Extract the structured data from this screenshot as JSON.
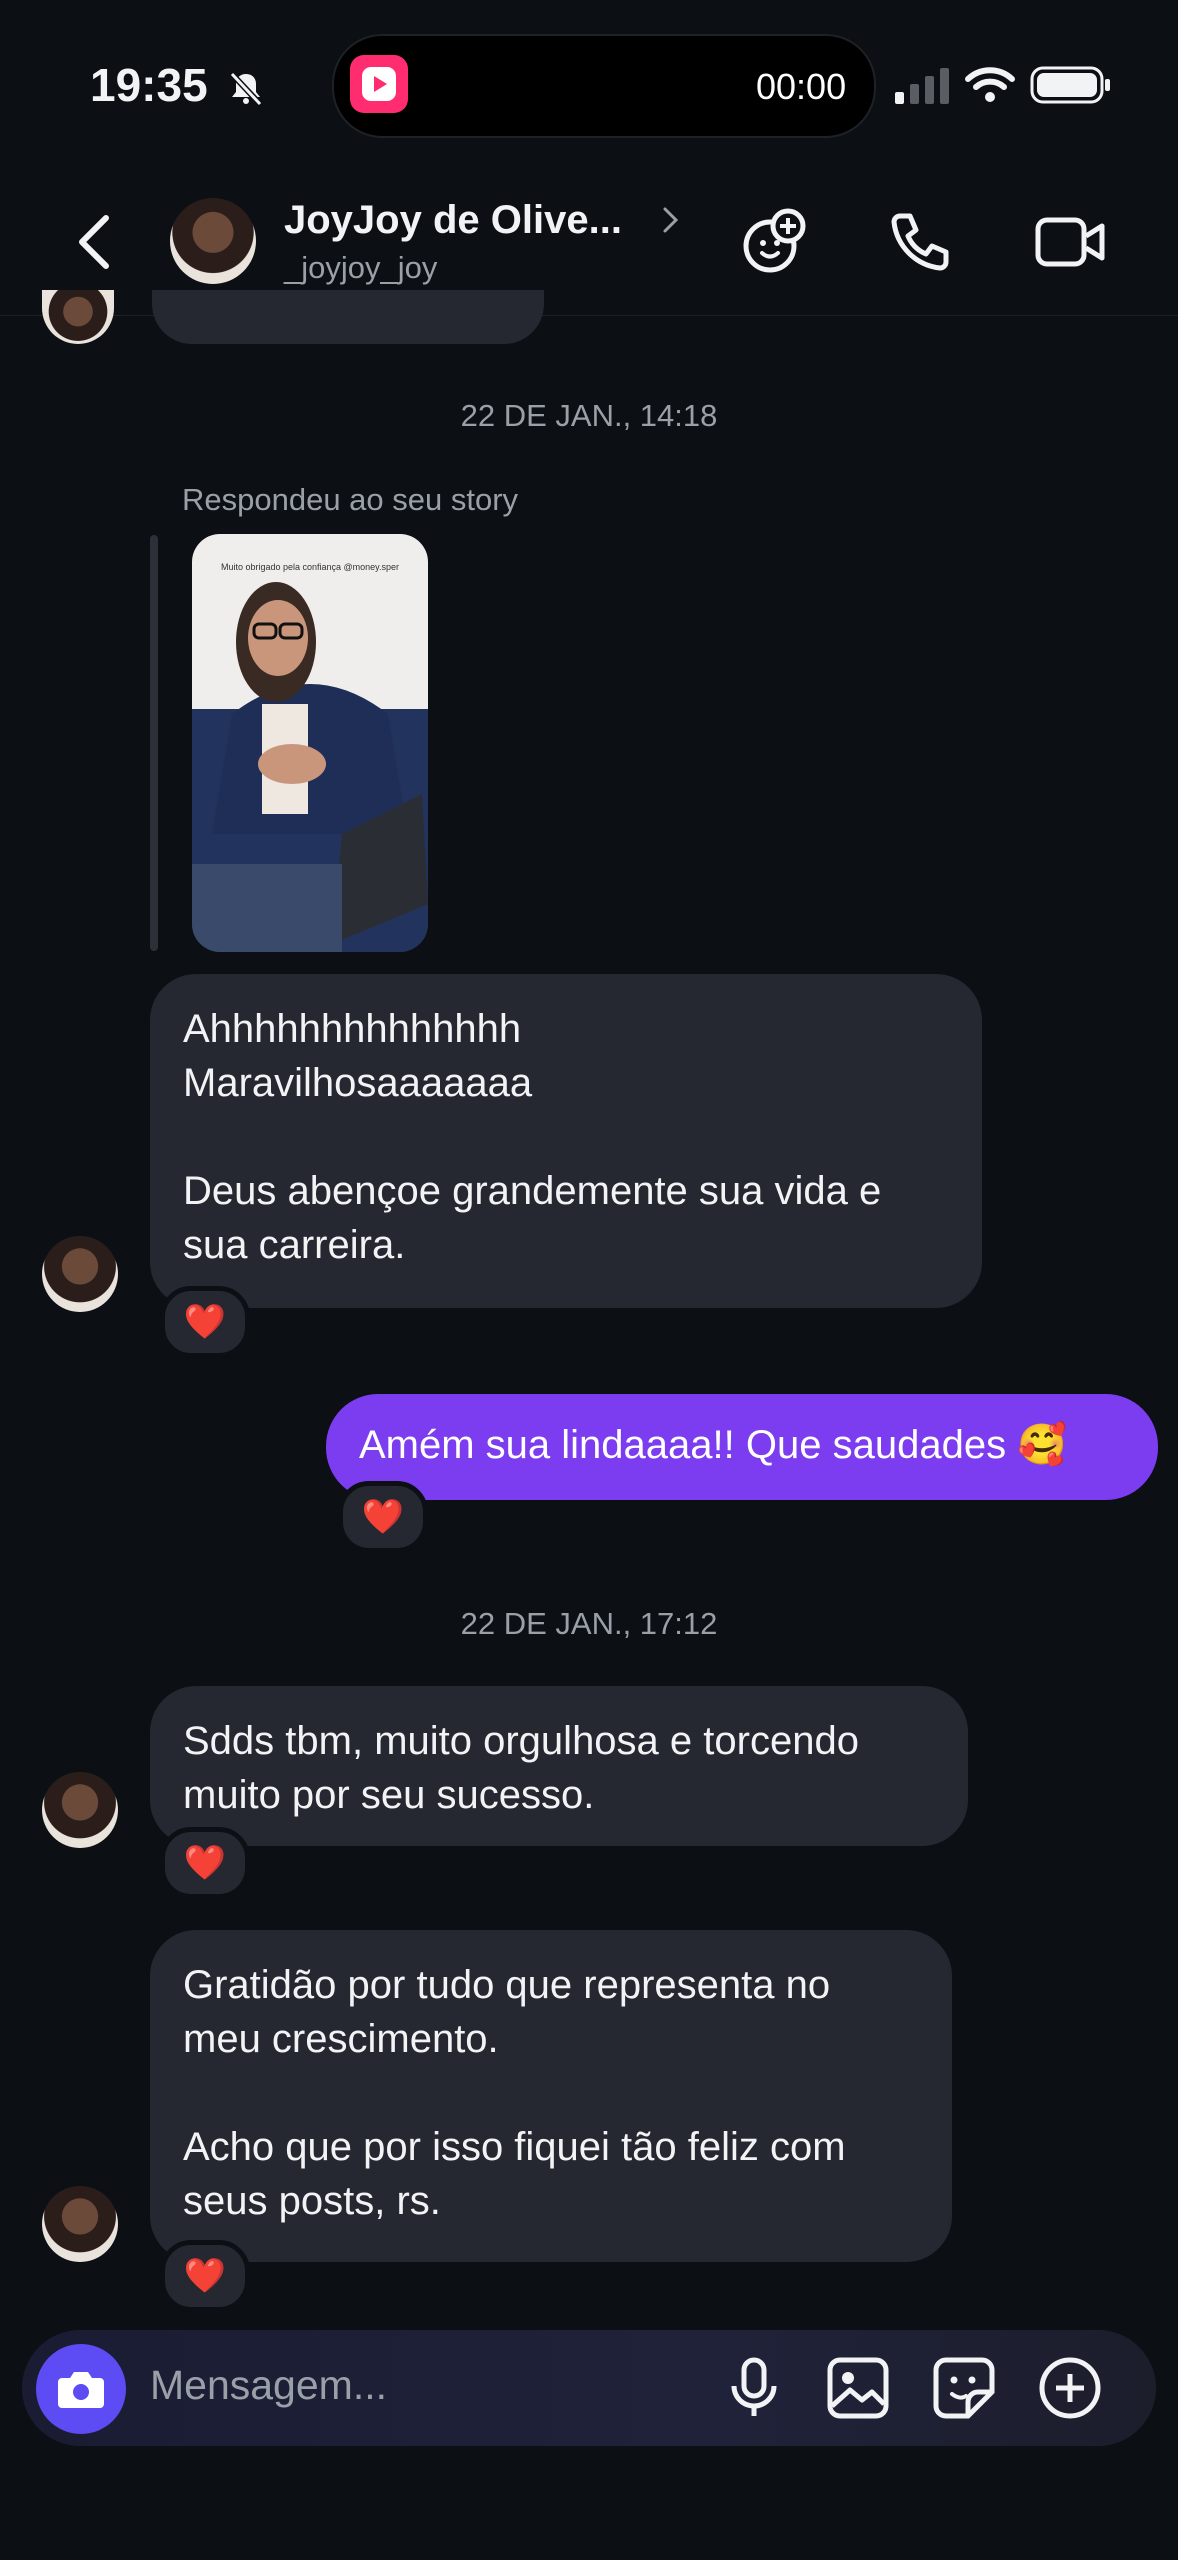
{
  "status_bar": {
    "time": "19:35",
    "timer": "00:00",
    "icons": [
      "bell-slash-icon",
      "signal-icon",
      "wifi-icon",
      "battery-icon"
    ]
  },
  "header": {
    "name": "JoyJoy de Olive...",
    "handle": "_joyjoy_joy",
    "actions": [
      "add-effect-icon",
      "phone-icon",
      "video-icon"
    ]
  },
  "thread": {
    "date1": "22 DE JAN., 14:18",
    "story_reply_label": "Respondeu ao seu story",
    "story_caption": "Muito obrigado pela confiança @money.sper",
    "msg1": "Ahhhhhhhhhhhhhh\nMaravilhosaaaaaaa\n\nDeus abençoe grandemente sua vida e sua carreira.",
    "msg1_reaction": "❤️",
    "msg2": "Amém sua lindaaaa!! Que saudades 🥰",
    "msg2_reaction": "❤️",
    "date2": "22 DE JAN., 17:12",
    "msg3": "Sdds tbm, muito orgulhosa e torcendo muito por seu sucesso.",
    "msg3_reaction": "❤️",
    "msg4": "Gratidão por tudo que representa no meu crescimento.\n\nAcho que por isso fiquei tão feliz com seus posts, rs.",
    "msg4_reaction": "❤️"
  },
  "composer": {
    "placeholder": "Mensagem...",
    "icons": [
      "camera-icon",
      "microphone-icon",
      "gallery-icon",
      "sticker-icon",
      "plus-icon"
    ]
  },
  "colors": {
    "background": "#0c0f14",
    "incoming_bubble": "#262831",
    "outgoing_bubble": "#7c3cf0",
    "camera_button": "#5d4cf3"
  }
}
